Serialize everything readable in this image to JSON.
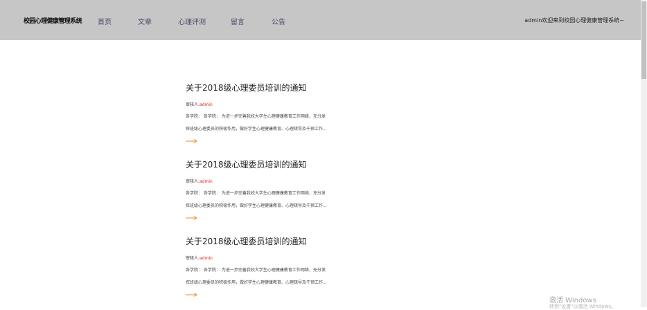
{
  "header": {
    "logo": "校园心理健康管理系统",
    "nav": [
      "首页",
      "文章",
      "心理评测",
      "留言",
      "公告"
    ],
    "greeting": "admin欢迎来到校园心理健康管理系统~"
  },
  "articles": [
    {
      "title": "关于2018级心理委员培训的通知",
      "author_label": "审核人:",
      "author": "admin",
      "excerpt_line1": "各学院：  各学院：  为进一步完善我校大学生心理健康教育工作网络，充分发",
      "excerpt_line2": "挥班级心理委员的积极作用，做好学生心理健康教育、心理疏导及干预工作..."
    },
    {
      "title": "关于2018级心理委员培训的通知",
      "author_label": "审核人:",
      "author": "admin",
      "excerpt_line1": "各学院：  各学院：  为进一步完善我校大学生心理健康教育工作网络，充分发",
      "excerpt_line2": "挥班级心理委员的积极作用，做好学生心理健康教育、心理疏导及干预工作..."
    },
    {
      "title": "关于2018级心理委员培训的通知",
      "author_label": "审核人:",
      "author": "admin",
      "excerpt_line1": "各学院：  各学院：  为进一步完善我校大学生心理健康教育工作网络，充分发",
      "excerpt_line2": "挥班级心理委员的积极作用，做好学生心理健康教育、心理疏导及干预工作..."
    }
  ],
  "colors": {
    "header_bg": "#c6c6c6",
    "accent": "#f08a24",
    "author": "#e0201e"
  },
  "icons": {
    "more": "arrow-right-icon"
  },
  "watermark": {
    "line1": "激活 Windows",
    "line2": "转到\"设置\"以激活 Windows。"
  }
}
